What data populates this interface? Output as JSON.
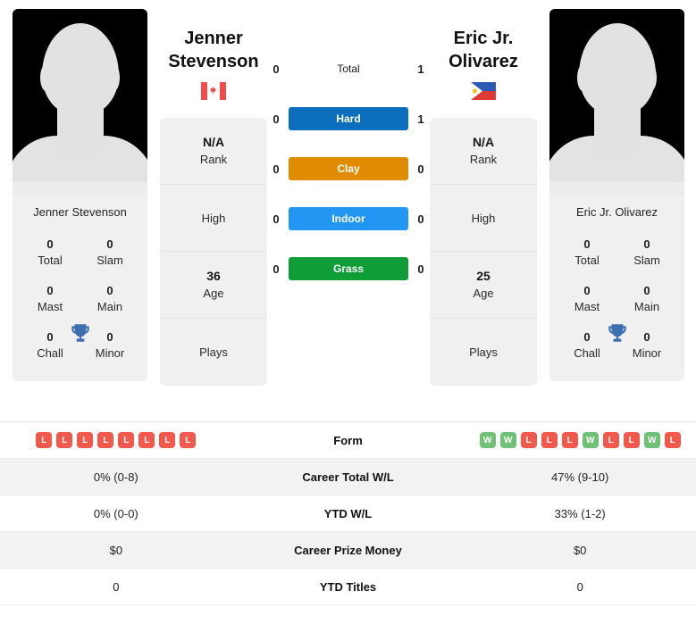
{
  "players": {
    "left": {
      "name": "Jenner Stevenson",
      "name_line1": "Jenner",
      "name_line2": "Stevenson",
      "flag": "canada-flag",
      "rank": "N/A",
      "rank_label": "Rank",
      "high_label": "High",
      "age": "36",
      "age_label": "Age",
      "plays_label": "Plays",
      "titles": [
        {
          "num": "0",
          "label": "Total"
        },
        {
          "num": "0",
          "label": "Slam"
        },
        {
          "num": "0",
          "label": "Mast"
        },
        {
          "num": "0",
          "label": "Main"
        },
        {
          "num": "0",
          "label": "Chall"
        },
        {
          "num": "0",
          "label": "Minor"
        }
      ],
      "form": [
        "L",
        "L",
        "L",
        "L",
        "L",
        "L",
        "L",
        "L"
      ]
    },
    "right": {
      "name": "Eric Jr. Olivarez",
      "name_line1": "Eric Jr.",
      "name_line2": "Olivarez",
      "flag": "philippines-flag",
      "rank": "N/A",
      "rank_label": "Rank",
      "high_label": "High",
      "age": "25",
      "age_label": "Age",
      "plays_label": "Plays",
      "titles": [
        {
          "num": "0",
          "label": "Total"
        },
        {
          "num": "0",
          "label": "Slam"
        },
        {
          "num": "0",
          "label": "Mast"
        },
        {
          "num": "0",
          "label": "Main"
        },
        {
          "num": "0",
          "label": "Chall"
        },
        {
          "num": "0",
          "label": "Minor"
        }
      ],
      "form": [
        "W",
        "W",
        "L",
        "L",
        "L",
        "W",
        "L",
        "L",
        "W",
        "L"
      ]
    }
  },
  "head_to_head": [
    {
      "label": "Total",
      "left": "0",
      "right": "1",
      "style": "plain",
      "color": ""
    },
    {
      "label": "Hard",
      "left": "0",
      "right": "1",
      "style": "surface",
      "color": "#0a6ebd"
    },
    {
      "label": "Clay",
      "left": "0",
      "right": "0",
      "style": "surface",
      "color": "#e08b00"
    },
    {
      "label": "Indoor",
      "left": "0",
      "right": "0",
      "style": "surface",
      "color": "#2196f3"
    },
    {
      "label": "Grass",
      "left": "0",
      "right": "0",
      "style": "surface",
      "color": "#0f9d38"
    }
  ],
  "stats_rows": [
    {
      "label": "Form",
      "left": "",
      "right": "",
      "type": "form"
    },
    {
      "label": "Career Total W/L",
      "left": "0% (0-8)",
      "right": "47% (9-10)",
      "type": "text"
    },
    {
      "label": "YTD W/L",
      "left": "0% (0-0)",
      "right": "33% (1-2)",
      "type": "text"
    },
    {
      "label": "Career Prize Money",
      "left": "$0",
      "right": "$0",
      "type": "text"
    },
    {
      "label": "YTD Titles",
      "left": "0",
      "right": "0",
      "type": "text"
    }
  ],
  "icons": {
    "trophy": "trophy-icon"
  },
  "colors": {
    "win": "#6ec175",
    "loss": "#f0594b",
    "hard": "#0a6ebd",
    "clay": "#e08b00",
    "indoor": "#2196f3",
    "grass": "#0f9d38",
    "trophy": "#3d6fb0"
  }
}
